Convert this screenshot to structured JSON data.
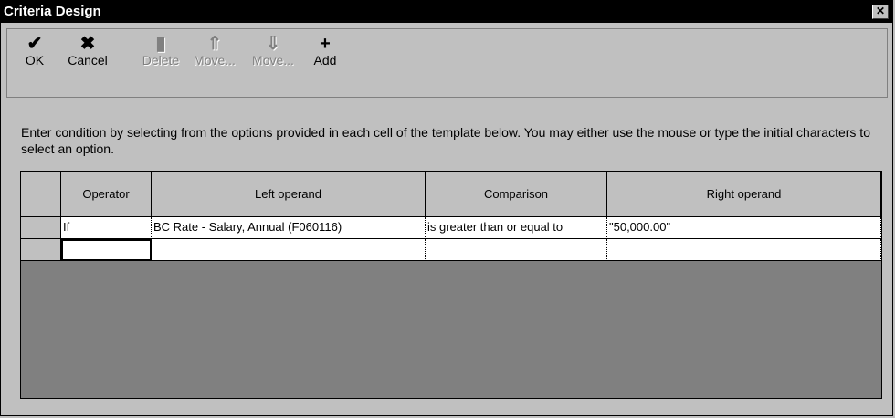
{
  "window": {
    "title": "Criteria Design",
    "close_glyph": "✕"
  },
  "toolbar": {
    "buttons": [
      {
        "label": "OK",
        "icon": "checkmark-icon",
        "glyph": "✔",
        "enabled": true
      },
      {
        "label": "Cancel",
        "icon": "cancel-x-icon",
        "glyph": "✖",
        "enabled": true
      },
      {
        "label": "Delete",
        "icon": "trash-icon",
        "glyph": "▮",
        "enabled": false
      },
      {
        "label": "Move...",
        "icon": "move-up-icon",
        "glyph": "⇑",
        "enabled": false
      },
      {
        "label": "Move...",
        "icon": "move-down-icon",
        "glyph": "⇓",
        "enabled": false
      },
      {
        "label": "Add",
        "icon": "plus-icon",
        "glyph": "+",
        "enabled": true
      }
    ]
  },
  "instructions": "Enter condition by selecting from the options provided in each cell of the template below. You may either use the mouse or type the initial characters to select an option.",
  "grid": {
    "columns": [
      "Operator",
      "Left operand",
      "Comparison",
      "Right operand"
    ],
    "rows": [
      [
        "If",
        "BC Rate - Salary, Annual (F060116)",
        "is greater than or equal to",
        "\"50,000.00\""
      ],
      [
        "",
        "",
        "",
        ""
      ]
    ]
  }
}
